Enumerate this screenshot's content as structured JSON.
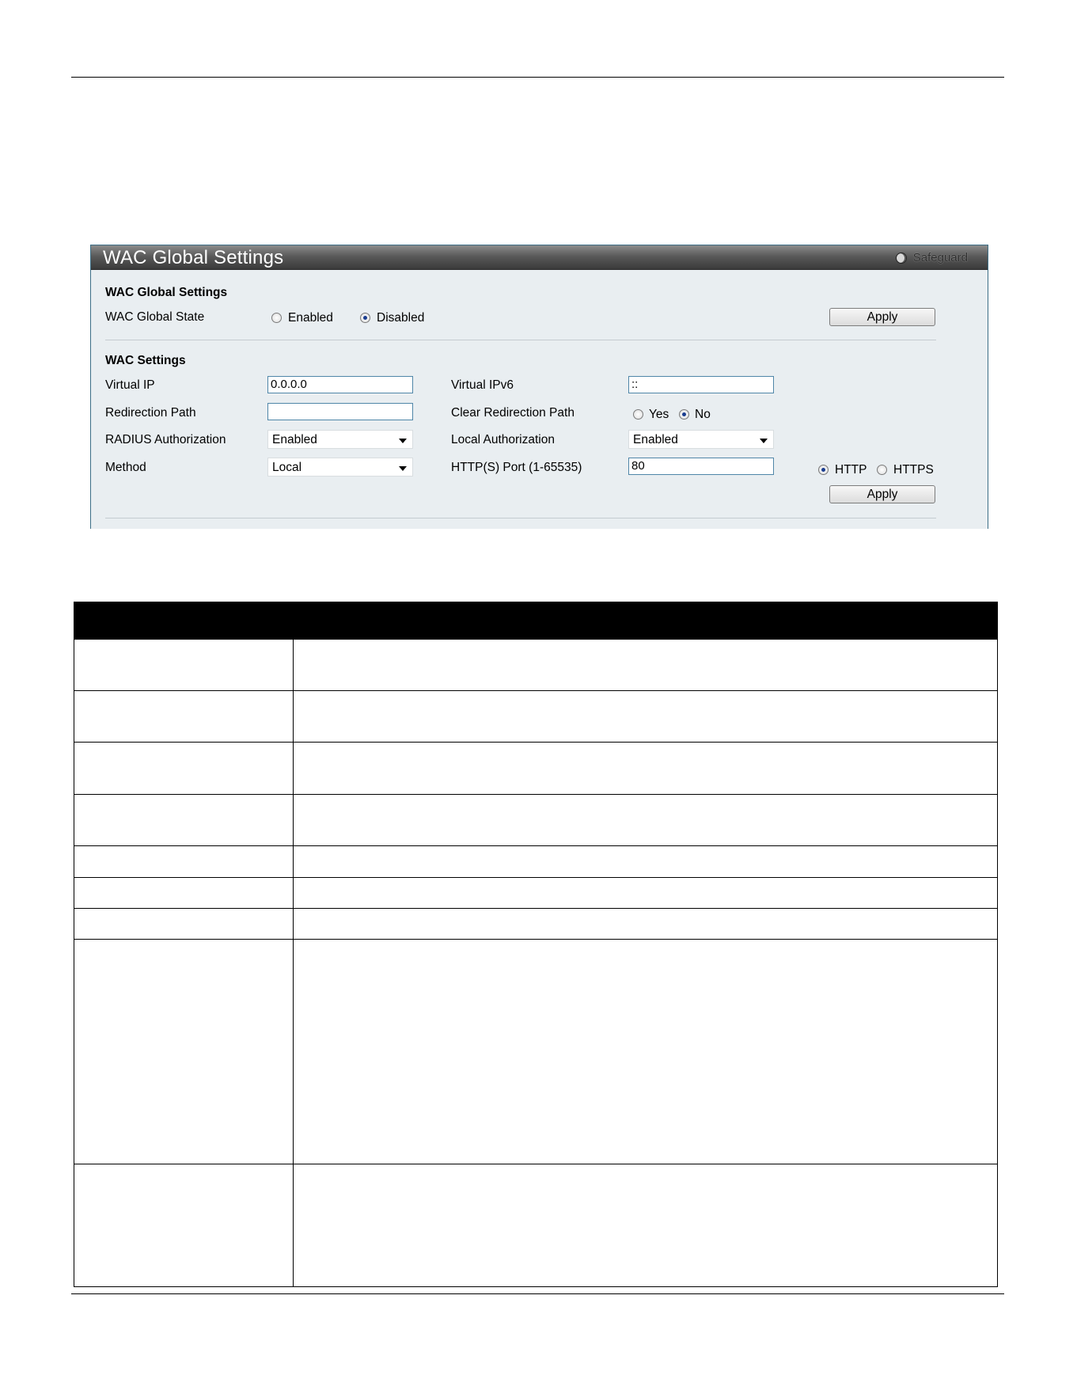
{
  "panel": {
    "title": "WAC Global Settings",
    "safeguard_label": "Safeguard"
  },
  "global_section": {
    "heading": "WAC Global Settings",
    "state_label": "WAC Global State",
    "options": [
      {
        "label": "Enabled",
        "checked": false
      },
      {
        "label": "Disabled",
        "checked": true
      }
    ],
    "apply_label": "Apply"
  },
  "wac_section": {
    "heading": "WAC Settings",
    "virtual_ip_label": "Virtual IP",
    "virtual_ip_value": "0.0.0.0",
    "virtual_ipv6_label": "Virtual IPv6",
    "virtual_ipv6_value": "::",
    "redirection_path_label": "Redirection Path",
    "redirection_path_value": "",
    "clear_redirection_label": "Clear Redirection Path",
    "clear_options": [
      {
        "label": "Yes",
        "checked": false
      },
      {
        "label": "No",
        "checked": true
      }
    ],
    "radius_auth_label": "RADIUS Authorization",
    "radius_auth_value": "Enabled",
    "local_auth_label": "Local Authorization",
    "local_auth_value": "Enabled",
    "method_label": "Method",
    "method_value": "Local",
    "port_label": "HTTP(S) Port (1-65535)",
    "port_value": "80",
    "protocol_options": [
      {
        "label": "HTTP",
        "checked": true
      },
      {
        "label": "HTTPS",
        "checked": false
      }
    ],
    "apply_label": "Apply"
  },
  "table": {
    "rows": 9
  }
}
